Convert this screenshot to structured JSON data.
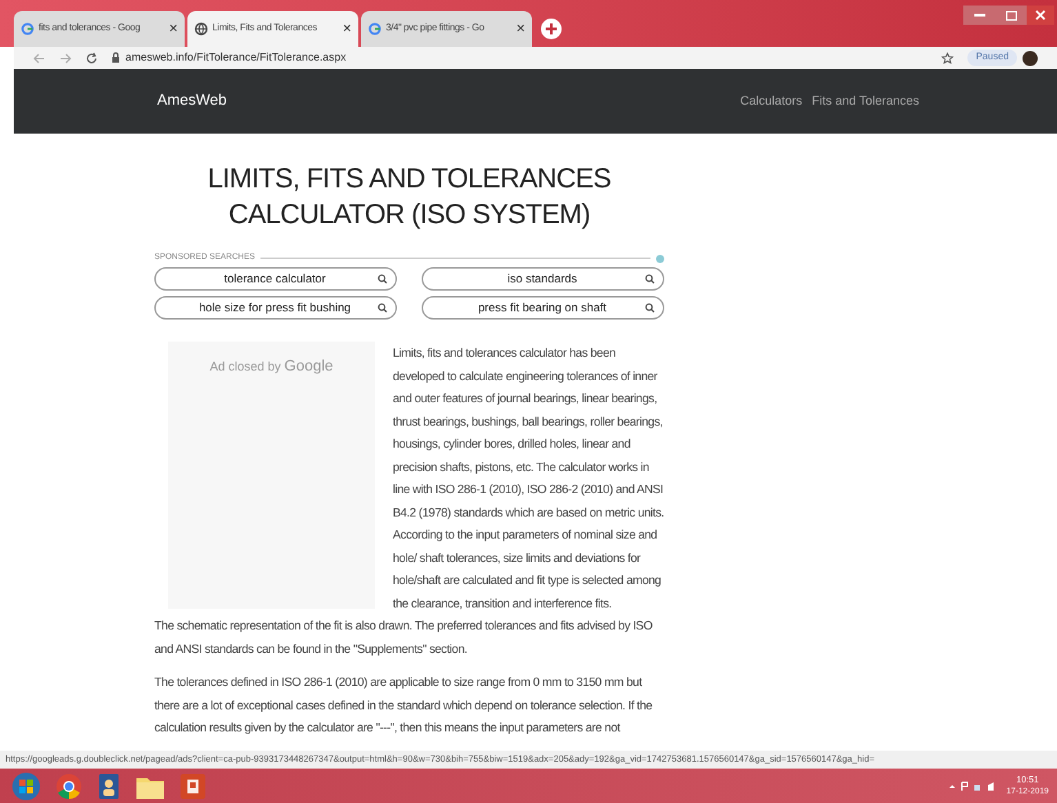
{
  "browser": {
    "tabs": [
      {
        "title": "fits and tolerances - Goog",
        "selected": false,
        "kind": "google"
      },
      {
        "title": "Limits, Fits and Tolerances",
        "selected": true,
        "kind": "globe"
      },
      {
        "title": "3/4\" pvc pipe fittings - Go",
        "selected": false,
        "kind": "google"
      }
    ],
    "close_glyph": "×",
    "address": "amesweb.info/FitTolerance/FitTolerance.aspx",
    "profile": "Paused"
  },
  "site": {
    "brand": "AmesWeb",
    "nav": [
      "Calculators",
      "Fits and Tolerances"
    ]
  },
  "page": {
    "title": "LIMITS, FITS AND TOLERANCES CALCULATOR (ISO SYSTEM)",
    "sponsored_label": "SPONSORED SEARCHES",
    "searches": [
      "tolerance calculator",
      "iso standards",
      "hole size for press fit bushing",
      "press fit bearing on shaft"
    ],
    "ad": {
      "text": "Ad closed by",
      "brand": "Google"
    },
    "paragraphs": [
      "Limits, fits and tolerances calculator has been developed to calculate engineering tolerances of inner and outer features of journal bearings, linear bearings, thrust bearings, bushings, ball bearings, roller bearings, housings, cylinder bores, drilled holes, linear and precision shafts, pistons, etc. The calculator works in line with ISO 286-1 (2010), ISO 286-2 (2010) and ANSI B4.2 (1978) standards which are based on metric units. According to the input parameters of nominal size and hole/ shaft tolerances, size limits and deviations for hole/shaft are calculated and fit type is selected among the clearance, transition and interference fits.",
      "The schematic representation of the fit is also drawn. The preferred tolerances and fits advised by ISO and ANSI standards can be found in the \"Supplements\" section.",
      "The tolerances defined in ISO 286-1 (2010) are applicable to size range from 0 mm to 3150 mm but there are a lot of exceptional cases defined in the standard which depend on tolerance selection. If the calculation results given by the calculator are \"---\", then this means the input parameters are not"
    ]
  },
  "status_url": "https://googleads.g.doubleclick.net/pagead/ads?client=ca-pub-9393173448267347&output=html&h=90&w=730&bih=755&biw=1519&adx=205&ady=192&ga_vid=1742753681.1576560147&ga_sid=1576560147&ga_hid=",
  "taskbar": {
    "time": "10:51",
    "date": "17-12-2019"
  }
}
